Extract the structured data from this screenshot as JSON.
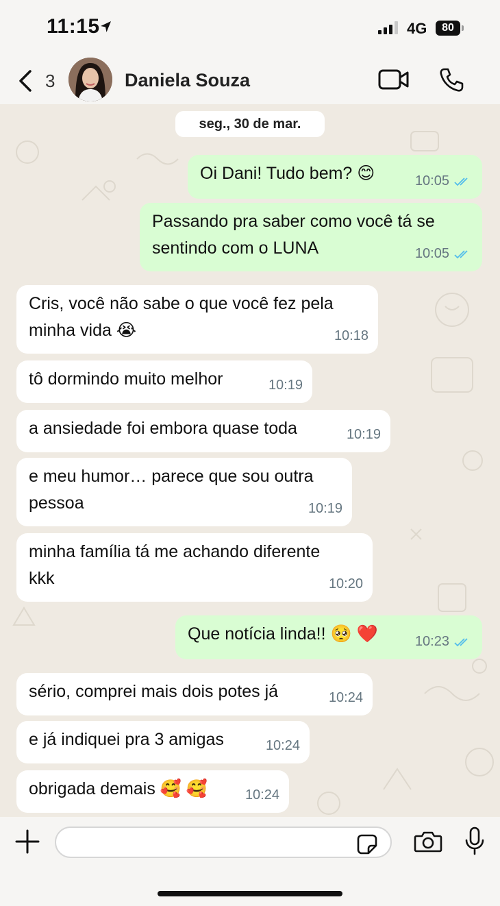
{
  "status_bar": {
    "time": "11:15",
    "network": "4G",
    "battery": "80"
  },
  "header": {
    "back_count": "3",
    "contact_name": "Daniela Souza"
  },
  "chat": {
    "date": "seg., 30 de mar.",
    "messages": [
      {
        "dir": "out",
        "text": "Oi Dani! Tudo bem? 😊",
        "time": "10:05",
        "read": true
      },
      {
        "dir": "out",
        "text": "Passando pra saber como você tá se\nsentindo com o LUNA",
        "time": "10:05",
        "read": true
      },
      {
        "dir": "in",
        "text": "Cris, você não sabe o que você fez pela\nminha vida 😭",
        "time": "10:18"
      },
      {
        "dir": "in",
        "text": "tô dormindo muito melhor",
        "time": "10:19"
      },
      {
        "dir": "in",
        "text": "a ansiedade foi embora quase toda",
        "time": "10:19"
      },
      {
        "dir": "in",
        "text": "e meu humor… parece que sou outra\npessoa",
        "time": "10:19"
      },
      {
        "dir": "in",
        "text": "minha família tá me achando diferente\nkkk",
        "time": "10:20"
      },
      {
        "dir": "out",
        "text": "Que notícia linda!! 🥺 ❤️",
        "time": "10:23",
        "read": true
      },
      {
        "dir": "in",
        "text": "sério, comprei mais dois potes já",
        "time": "10:24"
      },
      {
        "dir": "in",
        "text": "e já indiquei pra 3 amigas",
        "time": "10:24"
      },
      {
        "dir": "in",
        "text": "obrigada demais 🥰 🥰",
        "time": "10:24"
      }
    ]
  },
  "input": {
    "placeholder": ""
  },
  "colors": {
    "outgoing": "#d9fdd3",
    "incoming": "#ffffff",
    "ticks": "#53bdeb",
    "chat_bg": "#efeae2"
  },
  "icons": [
    "back-chevron-icon",
    "location-arrow-icon",
    "video-camera-icon",
    "phone-icon",
    "plus-icon",
    "sticker-icon",
    "camera-icon",
    "microphone-icon",
    "read-receipt-icon"
  ]
}
